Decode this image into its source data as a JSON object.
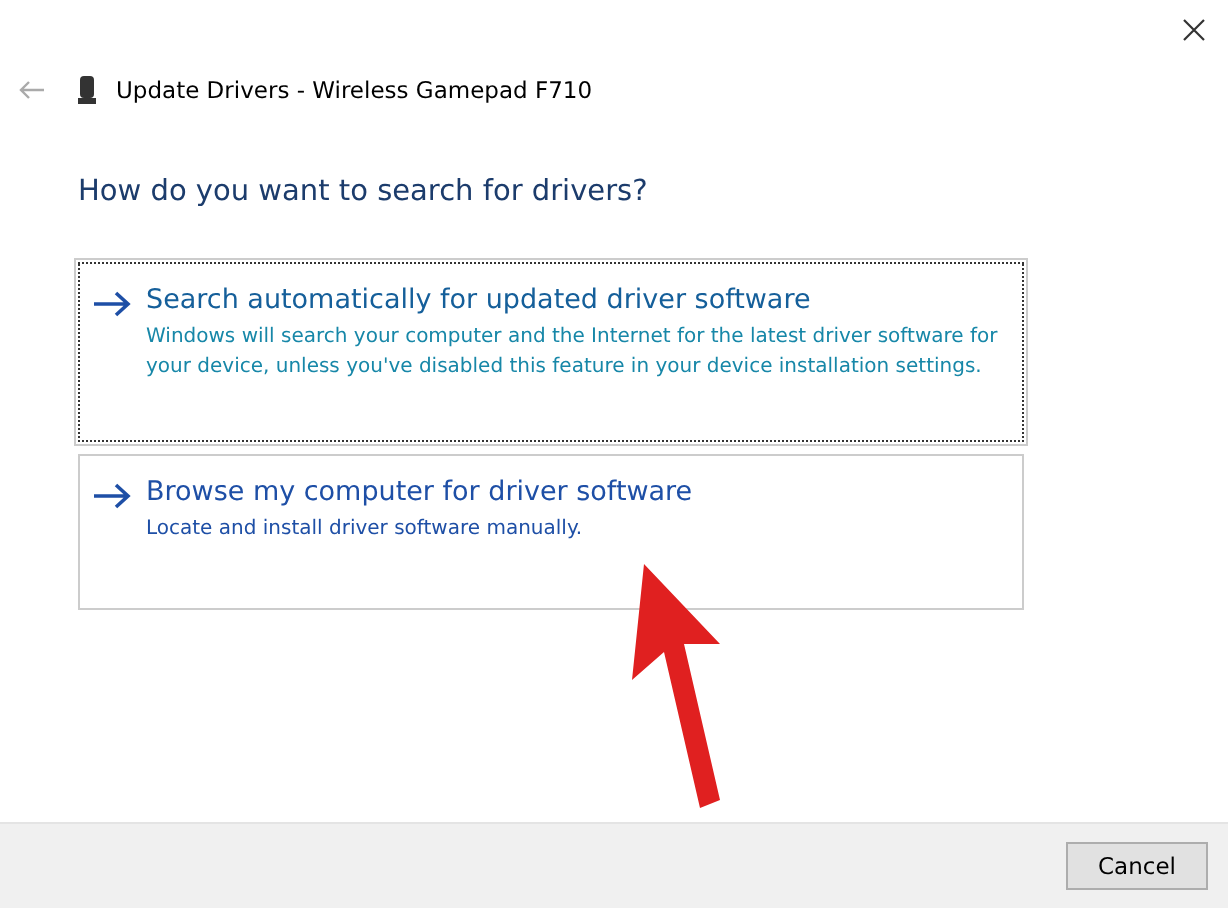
{
  "window": {
    "title": "Update Drivers - Wireless Gamepad F710"
  },
  "heading": "How do you want to search for drivers?",
  "options": [
    {
      "title": "Search automatically for updated driver software",
      "description": "Windows will search your computer and the Internet for the latest driver software for your device, unless you've disabled this feature in your device installation settings.",
      "focused": true
    },
    {
      "title": "Browse my computer for driver software",
      "description": "Locate and install driver software manually.",
      "focused": false
    }
  ],
  "buttons": [
    "Cancel"
  ]
}
